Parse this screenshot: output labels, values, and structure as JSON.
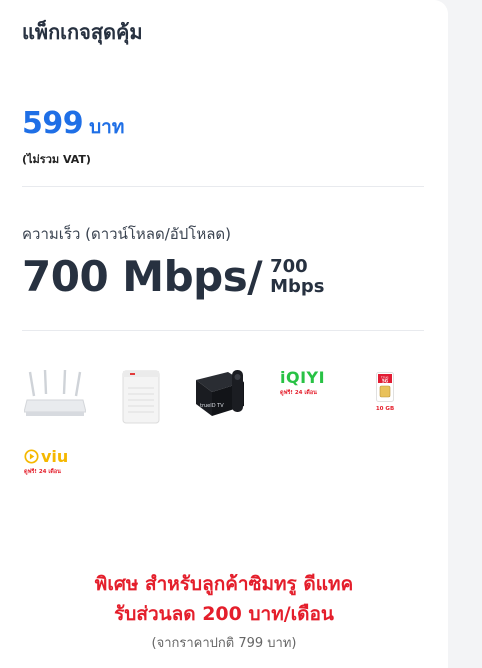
{
  "package": {
    "title": "แพ็กเกจสุดคุ้ม",
    "price": "599",
    "price_unit": "บาท",
    "vat_note": "(ไม่รวม VAT)",
    "speed_label": "ความเร็ว (ดาวน์โหลด/อัปโหลด)",
    "speed_download": "700 Mbps/",
    "speed_upload_value": "700",
    "speed_upload_unit": "Mbps"
  },
  "perks": {
    "iqiyi_logo": "iQIYI",
    "iqiyi_note": "ดูฟรี! 24 เดือน",
    "sim_brand": "true",
    "sim_tag": "5G",
    "sim_data": "10 GB",
    "viu_logo": "viu",
    "viu_note": "ดูฟรี! 24 เดือน",
    "box_brand": "trueID TV"
  },
  "promo": {
    "line1": "พิเศษ สำหรับลูกค้าซิมทรู ดีแทค",
    "line2": "รับส่วนลด 200 บาท/เดือน",
    "line3": "(จากราคาปกติ 799 บาท)"
  },
  "colors": {
    "price": "#1f6fe6",
    "promo": "#e41e2b",
    "iqiyi": "#28c245",
    "viu": "#f5b800"
  }
}
